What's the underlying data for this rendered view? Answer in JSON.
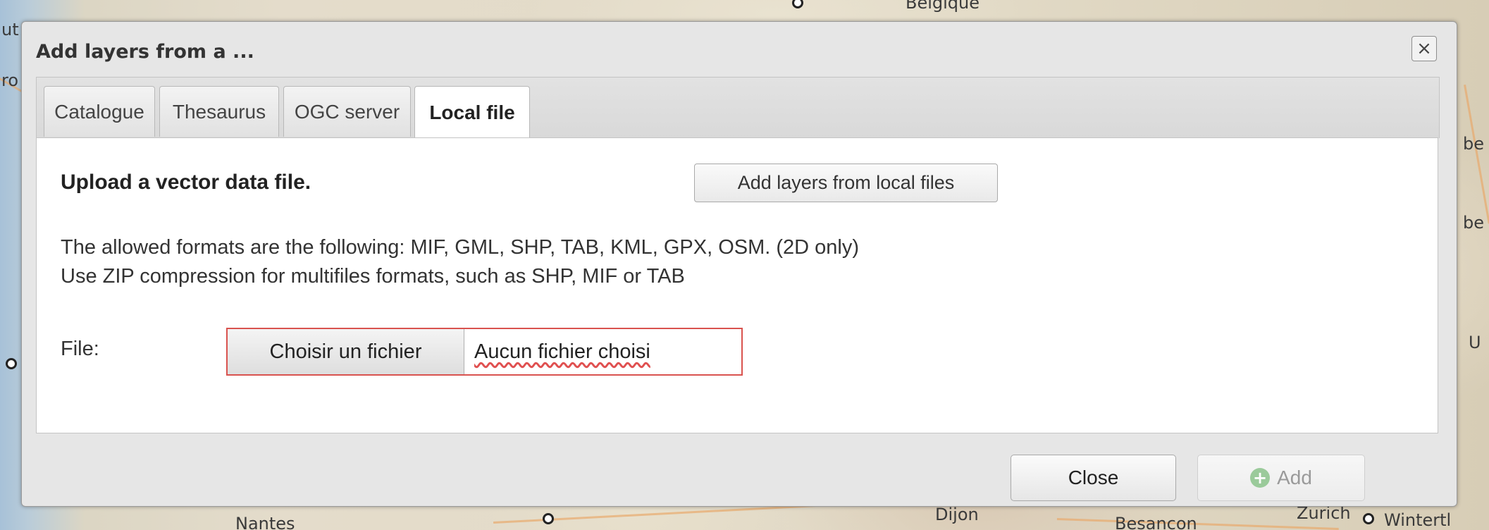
{
  "map": {
    "labels": {
      "belgique": "Belgique",
      "nantes": "Nantes",
      "dijon": "Dijon",
      "besancon": "Besancon",
      "winterthur": "Wintertl",
      "zurich": "Zurich",
      "left_ut": "ut",
      "left_ro": "ro",
      "right_be": "be",
      "right_be2": "be",
      "right_u": "U"
    }
  },
  "dialog": {
    "title": "Add layers from a ...",
    "close_icon": "×",
    "tabs": [
      {
        "label": "Catalogue"
      },
      {
        "label": "Thesaurus"
      },
      {
        "label": "OGC server"
      },
      {
        "label": "Local file"
      }
    ],
    "active_tab": "Local file",
    "content": {
      "heading": "Upload a vector data file.",
      "add_local_button": "Add layers from local files",
      "info_line1": "The allowed formats are the following: MIF, GML, SHP, TAB, KML, GPX, OSM. (2D only)",
      "info_line2": "Use ZIP compression for multifiles formats, such as SHP, MIF or TAB",
      "file_label": "File:",
      "file_button": "Choisir un fichier",
      "file_status": "Aucun fichier choisi"
    },
    "footer": {
      "close_button": "Close",
      "add_button": "Add",
      "add_icon": "+"
    }
  }
}
